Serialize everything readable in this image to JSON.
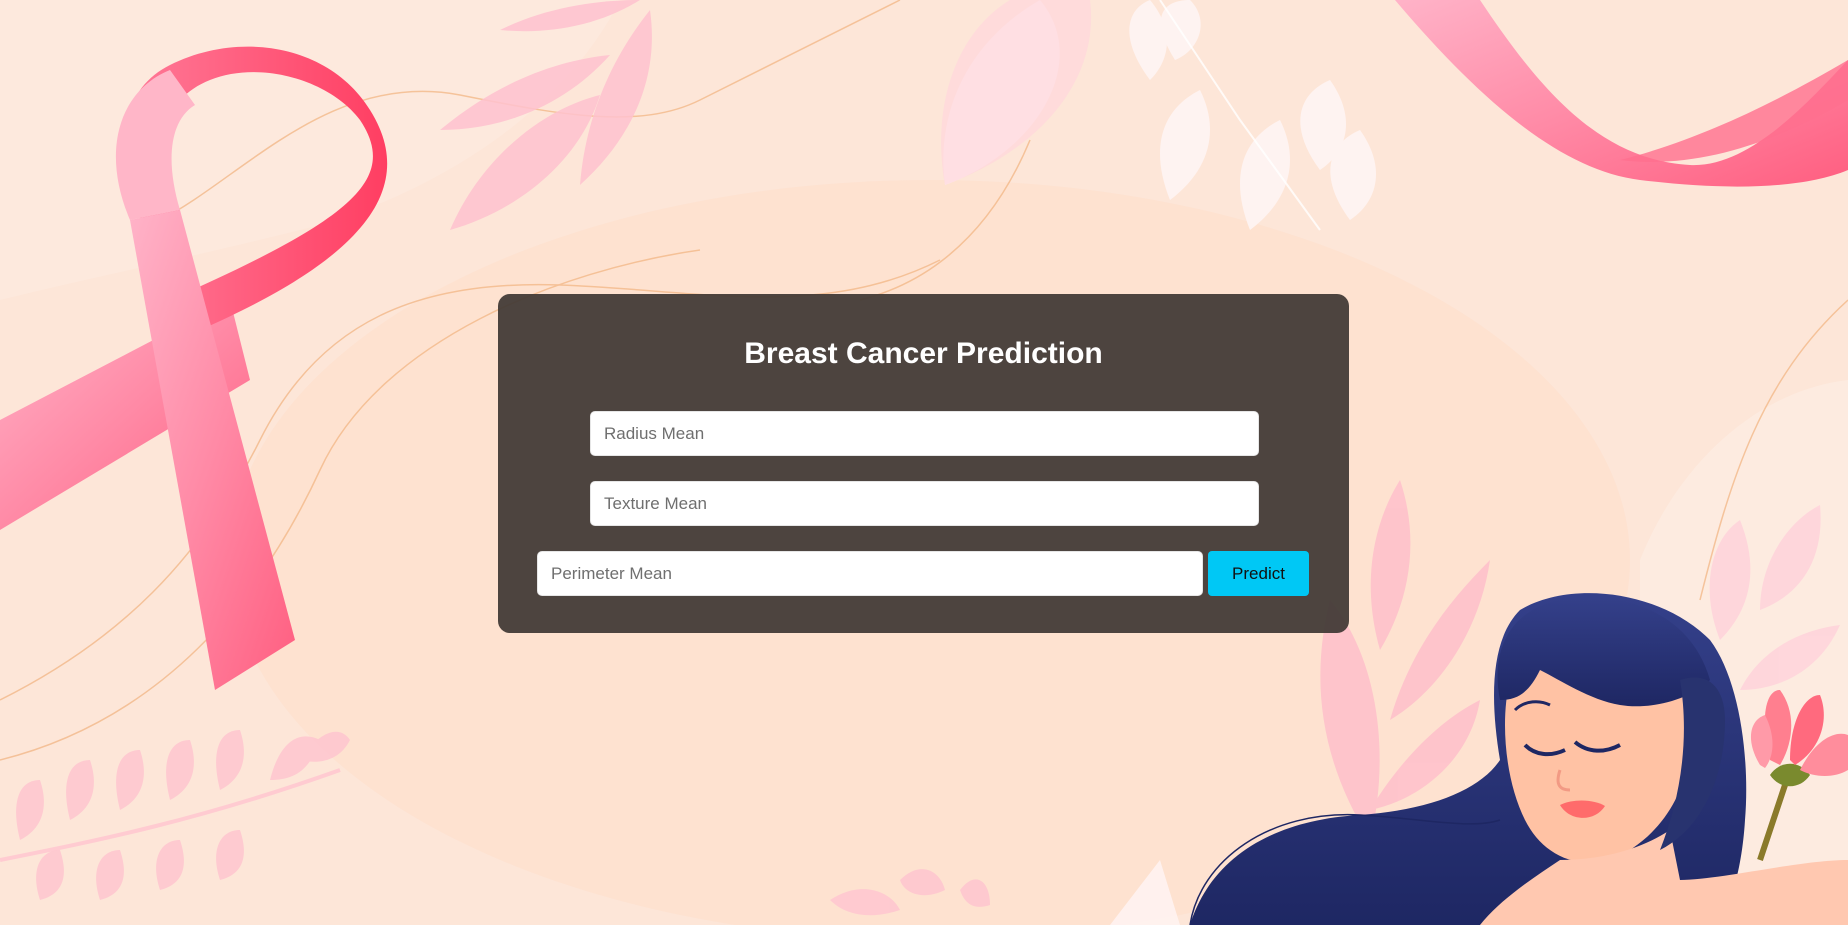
{
  "form": {
    "title": "Breast Cancer Prediction",
    "fields": [
      {
        "placeholder": "Radius Mean",
        "value": ""
      },
      {
        "placeholder": "Texture Mean",
        "value": ""
      },
      {
        "placeholder": "Perimeter Mean",
        "value": ""
      }
    ],
    "submit_label": "Predict"
  },
  "colors": {
    "background": "#fde6d8",
    "card": "#403834",
    "button": "#00c8f5",
    "ribbon": "#ff7a98",
    "hair": "#2a3476"
  },
  "decor": {
    "illustrations": [
      "pink-ribbon",
      "leaves",
      "woman-illustration",
      "flower"
    ]
  }
}
